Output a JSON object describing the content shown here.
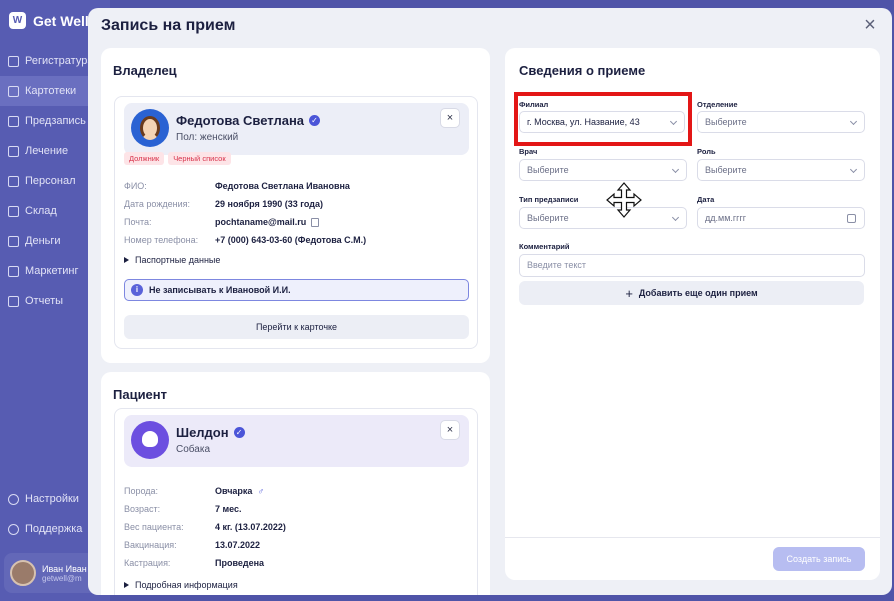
{
  "app": {
    "name": "Get Well",
    "logo_letter": "W"
  },
  "sidebar": {
    "items": [
      {
        "label": "Регистратура"
      },
      {
        "label": "Картотеки",
        "active": true
      },
      {
        "label": "Предзапись"
      },
      {
        "label": "Лечение"
      },
      {
        "label": "Персонал"
      },
      {
        "label": "Склад"
      },
      {
        "label": "Деньги"
      },
      {
        "label": "Маркетинг"
      },
      {
        "label": "Отчеты"
      }
    ],
    "bottom_items": [
      {
        "label": "Настройки"
      },
      {
        "label": "Поддержка"
      }
    ],
    "user": {
      "name": "Иван Иван",
      "email": "getwell@m"
    }
  },
  "modal": {
    "title": "Запись на прием",
    "close_symbol": "×"
  },
  "owner": {
    "section_title": "Владелец",
    "name": "Федотова Светлана",
    "gender": "Пол: женский",
    "badges": [
      "Должник",
      "Черный список"
    ],
    "fields": [
      {
        "label": "ФИО:",
        "value": "Федотова Светлана Ивановна"
      },
      {
        "label": "Дата рождения:",
        "value": "29 ноября 1990 (33 года)"
      },
      {
        "label": "Почта:",
        "value": "pochtaname@mail.ru"
      },
      {
        "label": "Номер телефона:",
        "value": "+7 (000) 643-03-60 (Федотова С.М.)"
      }
    ],
    "passport_toggle": "Паспортные данные",
    "notice": "Не записывать к Ивановой И.И.",
    "goto_button": "Перейти к карточке",
    "remove_symbol": "×"
  },
  "patient": {
    "section_title": "Пациент",
    "name": "Шелдон",
    "species": "Собака",
    "fields": [
      {
        "label": "Порода:",
        "value": "Овчарка"
      },
      {
        "label": "Возраст:",
        "value": "7 мес."
      },
      {
        "label": "Вес пациента:",
        "value": "4 кг. (13.07.2022)"
      },
      {
        "label": "Вакцинация:",
        "value": "13.07.2022"
      },
      {
        "label": "Кастрация:",
        "value": "Проведена"
      }
    ],
    "gender_symbol": "♂",
    "details_toggle": "Подробная информация",
    "remove_symbol": "×"
  },
  "appointment": {
    "section_title": "Сведения о приеме",
    "branch": {
      "label": "Филиал",
      "value": "г. Москва, ул. Название, 43"
    },
    "department": {
      "label": "Отделение",
      "placeholder": "Выберите"
    },
    "doctor": {
      "label": "Врач",
      "placeholder": "Выберите"
    },
    "role": {
      "label": "Роль",
      "placeholder": "Выберите"
    },
    "prebooking_type": {
      "label": "Тип предзаписи",
      "placeholder": "Выберите"
    },
    "date": {
      "label": "Дата",
      "placeholder": "дд.мм.гггг"
    },
    "comment": {
      "label": "Комментарий",
      "placeholder": "Введите текст"
    },
    "add_button": "Добавить еще один прием",
    "submit_button": "Создать запись"
  },
  "colors": {
    "sidebar": "#575cb2",
    "accent": "#4b55d8",
    "highlight": "#e31616",
    "badge_text": "#d8334b"
  }
}
